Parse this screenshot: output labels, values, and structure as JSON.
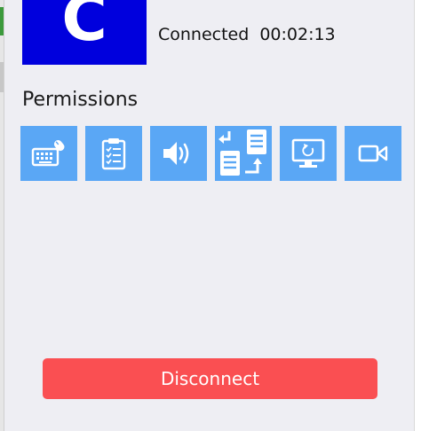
{
  "avatar": {
    "letter": "C",
    "color": "#0000dd"
  },
  "status": {
    "state": "Connected",
    "duration": "00:02:13"
  },
  "permissions": {
    "title": "Permissions",
    "accent": "#5aa7f5",
    "items": [
      {
        "id": "keyboard",
        "icon": "keyboard-mouse-icon"
      },
      {
        "id": "clipboard",
        "icon": "clipboard-icon"
      },
      {
        "id": "audio",
        "icon": "speaker-icon"
      },
      {
        "id": "file-transfer",
        "icon": "file-transfer-icon"
      },
      {
        "id": "restart",
        "icon": "monitor-restart-icon"
      },
      {
        "id": "recording",
        "icon": "video-camera-icon"
      }
    ]
  },
  "disconnect": {
    "label": "Disconnect",
    "color": "#fa4f52"
  }
}
